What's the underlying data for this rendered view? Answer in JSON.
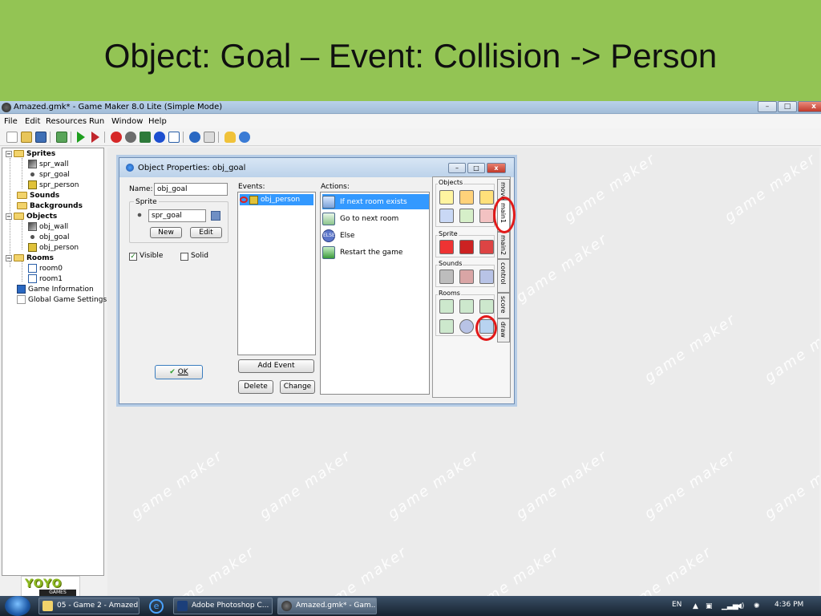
{
  "slide": {
    "title": "Object: Goal – Event: Collision -> Person"
  },
  "window": {
    "title": "Amazed.gmk* - Game Maker 8.0 Lite (Simple Mode)",
    "buttons": {
      "minimize": "–",
      "maximize": "□",
      "close": "x"
    }
  },
  "menu": [
    "File",
    "Edit",
    "Resources",
    "Run",
    "Window",
    "Help"
  ],
  "tree": {
    "sprites": "Sprites",
    "spr_wall": "spr_wall",
    "spr_goal": "spr_goal",
    "spr_person": "spr_person",
    "sounds": "Sounds",
    "backgrounds": "Backgrounds",
    "objects": "Objects",
    "obj_wall": "obj_wall",
    "obj_goal": "obj_goal",
    "obj_person": "obj_person",
    "rooms": "Rooms",
    "room0": "room0",
    "room1": "room1",
    "game_info": "Game Information",
    "global_settings": "Global Game Settings"
  },
  "logo": {
    "brand": "YOYO",
    "sub": "GAMES"
  },
  "watermark": "game maker",
  "dialog": {
    "title": "Object Properties: obj_goal",
    "buttons": {
      "minimize": "–",
      "maximize": "□",
      "close": "x"
    },
    "name_label": "Name:",
    "name_value": "obj_goal",
    "sprite_label": "Sprite",
    "sprite_value": "spr_goal",
    "new_button": "New",
    "edit_button": "Edit",
    "visible_label": "Visible",
    "visible_checked": "✓",
    "solid_label": "Solid",
    "ok_button": "OK",
    "ok_check": "✔",
    "events_label": "Events:",
    "events": [
      "obj_person"
    ],
    "add_event": "Add Event",
    "delete": "Delete",
    "change": "Change",
    "actions_label": "Actions:",
    "actions": [
      "If next room exists",
      "Go to next room",
      "Else",
      "Restart the game"
    ],
    "else_icon_text": "ELSE"
  },
  "palette": {
    "objects_label": "Objects",
    "sprite_label": "Sprite",
    "sounds_label": "Sounds",
    "rooms_label": "Rooms",
    "tabs": [
      "move",
      "main1",
      "main2",
      "control",
      "score",
      "draw"
    ]
  },
  "taskbar": {
    "tasks": [
      "05 - Game 2 - Amazed",
      "Adobe Photoshop C...",
      "Amazed.gmk* - Gam..."
    ],
    "lang": "EN",
    "clock": "4:36 PM"
  },
  "colors": {
    "slide_bg": "#93c454",
    "selection": "#3399ff",
    "highlight_ring": "#e21919"
  }
}
